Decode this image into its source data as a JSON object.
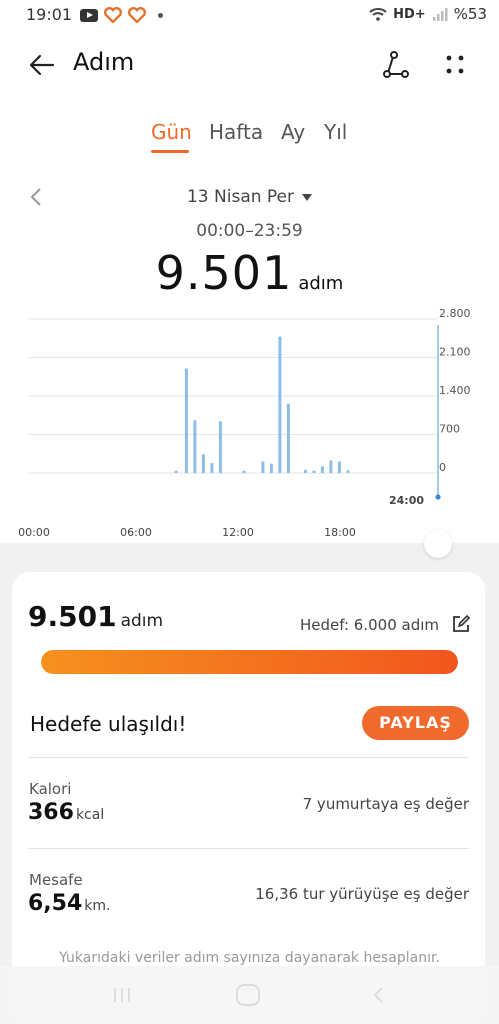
{
  "status_bar": {
    "time": "19:01",
    "network": "HD+",
    "battery": "%53",
    "icons": [
      "youtube-icon",
      "heart-app-icon",
      "heart-app-icon",
      "dot-icon",
      "wifi-icon",
      "signal-icon"
    ]
  },
  "app_bar": {
    "title": "Adım",
    "back_icon": "arrow-left-icon",
    "share_icon": "route-share-icon",
    "more_icon": "more-dots-icon"
  },
  "tabs": [
    {
      "label": "Gün",
      "active": true
    },
    {
      "label": "Hafta",
      "active": false
    },
    {
      "label": "Ay",
      "active": false
    },
    {
      "label": "Yıl",
      "active": false
    }
  ],
  "date_nav": {
    "date": "13 Nisan Per",
    "time_range": "00:00–23:59"
  },
  "summary": {
    "steps": "9.501",
    "unit": "adım"
  },
  "chart_data": {
    "type": "bar",
    "y_ticks": [
      "2.800",
      "2.100",
      "1.400",
      "700",
      "0"
    ],
    "ylim": [
      0,
      2800
    ],
    "x_ticks": [
      "00:00",
      "06:00",
      "12:00",
      "18:00"
    ],
    "end_marker": "24:00",
    "bar_color": "#8dbde7",
    "grid": true,
    "bars": [
      {
        "hour": 8.6,
        "value": 40
      },
      {
        "hour": 9.2,
        "value": 1900
      },
      {
        "hour": 9.7,
        "value": 960
      },
      {
        "hour": 10.2,
        "value": 340
      },
      {
        "hour": 10.7,
        "value": 180
      },
      {
        "hour": 11.2,
        "value": 940
      },
      {
        "hour": 12.6,
        "value": 40
      },
      {
        "hour": 13.7,
        "value": 210
      },
      {
        "hour": 14.2,
        "value": 170
      },
      {
        "hour": 14.7,
        "value": 2480
      },
      {
        "hour": 15.2,
        "value": 1260
      },
      {
        "hour": 16.2,
        "value": 60
      },
      {
        "hour": 16.7,
        "value": 40
      },
      {
        "hour": 17.2,
        "value": 120
      },
      {
        "hour": 17.7,
        "value": 230
      },
      {
        "hour": 18.2,
        "value": 210
      },
      {
        "hour": 18.7,
        "value": 50
      }
    ]
  },
  "card": {
    "steps": "9.501",
    "steps_unit": "adım",
    "goal": "Hedef: 6.000 adım",
    "edit_icon": "edit-icon",
    "progress": 1.0,
    "progress_colors": [
      "#f6911f",
      "#f2561d"
    ],
    "reached": "Hedefe ulaşıldı!",
    "share_button": "PAYLAŞ",
    "metrics": [
      {
        "label": "Kalori",
        "value": "366",
        "unit": "kcal",
        "equivalent": "7 yumurtaya eş değer"
      },
      {
        "label": "Mesafe",
        "value": "6,54",
        "unit": "km.",
        "equivalent": "16,36 tur yürüyüşe eş değer"
      }
    ],
    "footnote": "Yukarıdaki veriler adım sayınıza dayanarak hesaplanır."
  },
  "accent_color": "#ee6a2a"
}
